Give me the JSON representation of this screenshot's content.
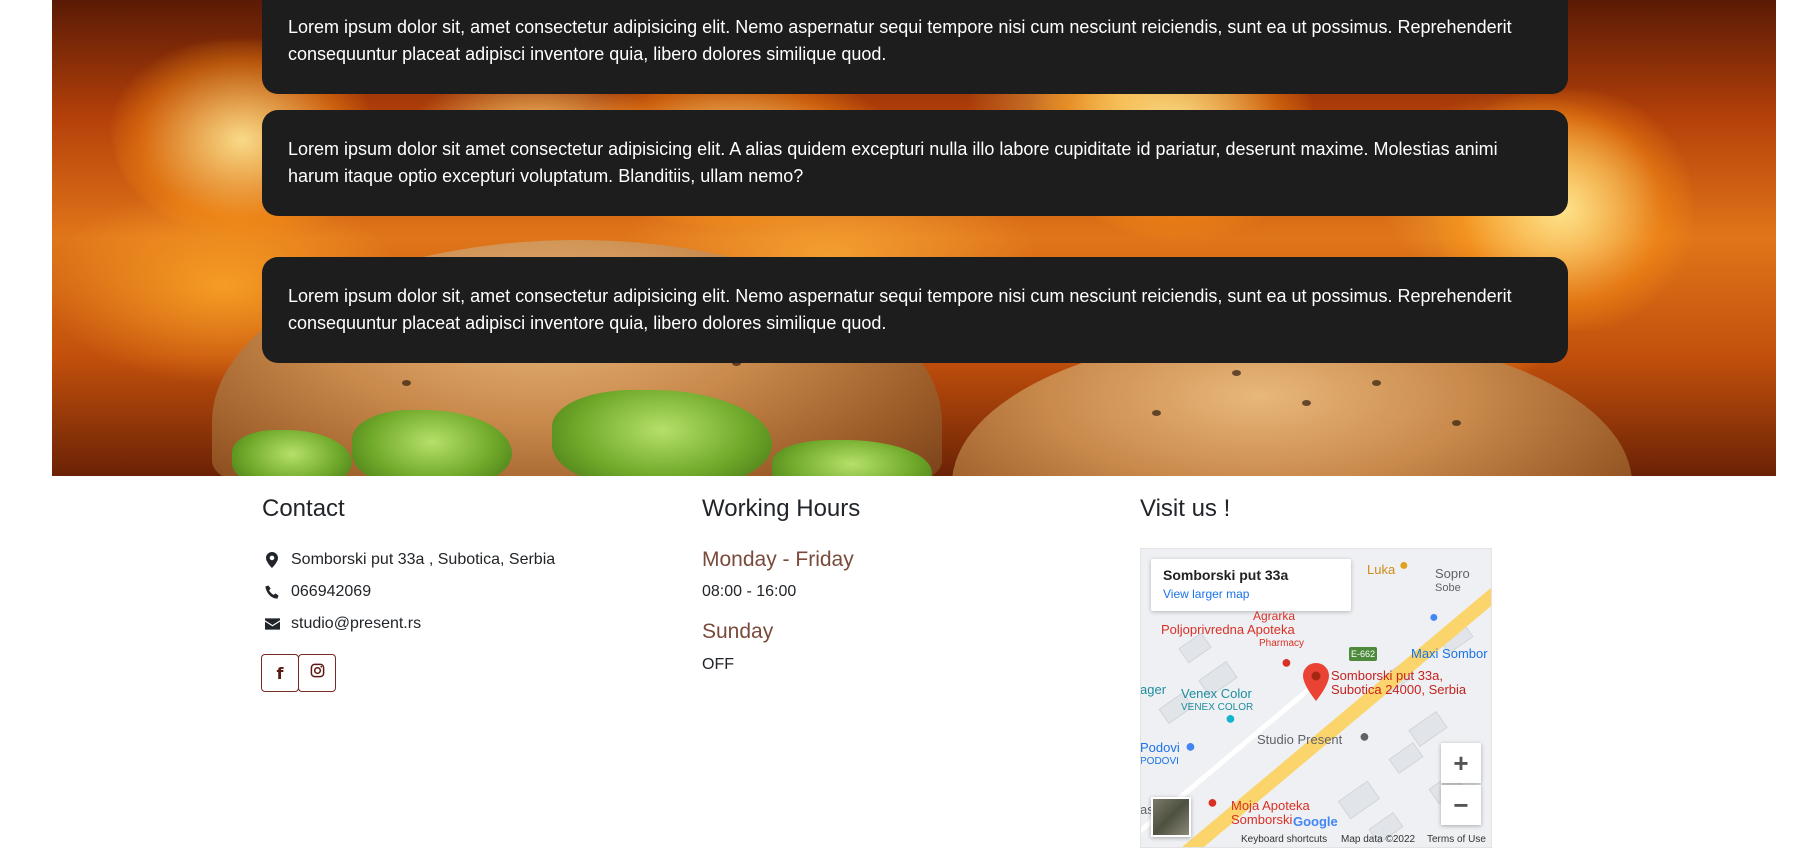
{
  "testimonials": [
    {
      "text": "Lorem ipsum dolor sit, amet consectetur adipisicing elit. Nemo aspernatur sequi tempore nisi cum nesciunt reiciendis, sunt ea ut possimus. Reprehenderit consequuntur placeat adipisci inventore quia, libero dolores similique quod."
    },
    {
      "text": "Lorem ipsum dolor sit amet consectetur adipisicing elit. A alias quidem excepturi nulla illo labore cupiditate id pariatur, deserunt maxime. Molestias animi harum itaque optio excepturi voluptatum. Blanditiis, ullam nemo?"
    },
    {
      "text": "Lorem ipsum dolor sit, amet consectetur adipisicing elit. Nemo aspernatur sequi tempore nisi cum nesciunt reiciendis, sunt ea ut possimus. Reprehenderit consequuntur placeat adipisci inventore quia, libero dolores similique quod."
    }
  ],
  "contact": {
    "title": "Contact",
    "address": "Somborski put 33a , Subotica, Serbia",
    "phone": "066942069",
    "email": "studio@present.rs",
    "address_icon": "map-marker-icon",
    "phone_icon": "phone-icon",
    "email_icon": "envelope-icon",
    "facebook_icon": "facebook-icon",
    "instagram_icon": "instagram-icon"
  },
  "hours": {
    "title": "Working Hours",
    "weekday_label": "Monday - Friday",
    "weekday_time": "08:00 - 16:00",
    "sunday_label": "Sunday",
    "sunday_time": "OFF"
  },
  "visit": {
    "title": "Visit us !",
    "map": {
      "place_title": "Somborski put 33a",
      "larger_map_link": "View larger map",
      "poi_luka": "Luka",
      "poi_sopro": "Sopro",
      "poi_sopro2": "Sobe",
      "poi_agrarka": "Agrarka",
      "poi_poljo": "Poljoprivredna Apoteka",
      "poi_pharmacy": "Pharmacy",
      "poi_e662": "E-662",
      "poi_maxi": "Maxi Sombor",
      "marker_label_1": "Somborski put 33a,",
      "marker_label_2": "Subotica 24000, Serbia",
      "poi_ager": "ager",
      "poi_venex": "Venex Color",
      "poi_venex2": "VENEX COLOR",
      "poi_studio": "Studio Present",
      "poi_podovi": "Podovi",
      "poi_podovi2": "PODOVI",
      "poi_moja1": "Moja Apoteka",
      "poi_moja2": "Somborski",
      "poi_as": "as",
      "google": "Google",
      "keyboard": "Keyboard shortcuts",
      "mapdata": "Map data ©2022",
      "terms": "Terms of Use",
      "zoom_in": "+",
      "zoom_out": "−"
    }
  },
  "colors": {
    "card_bg": "#1d1d1d",
    "accent": "#7a2a24",
    "hours_label": "#7a4a3a"
  }
}
